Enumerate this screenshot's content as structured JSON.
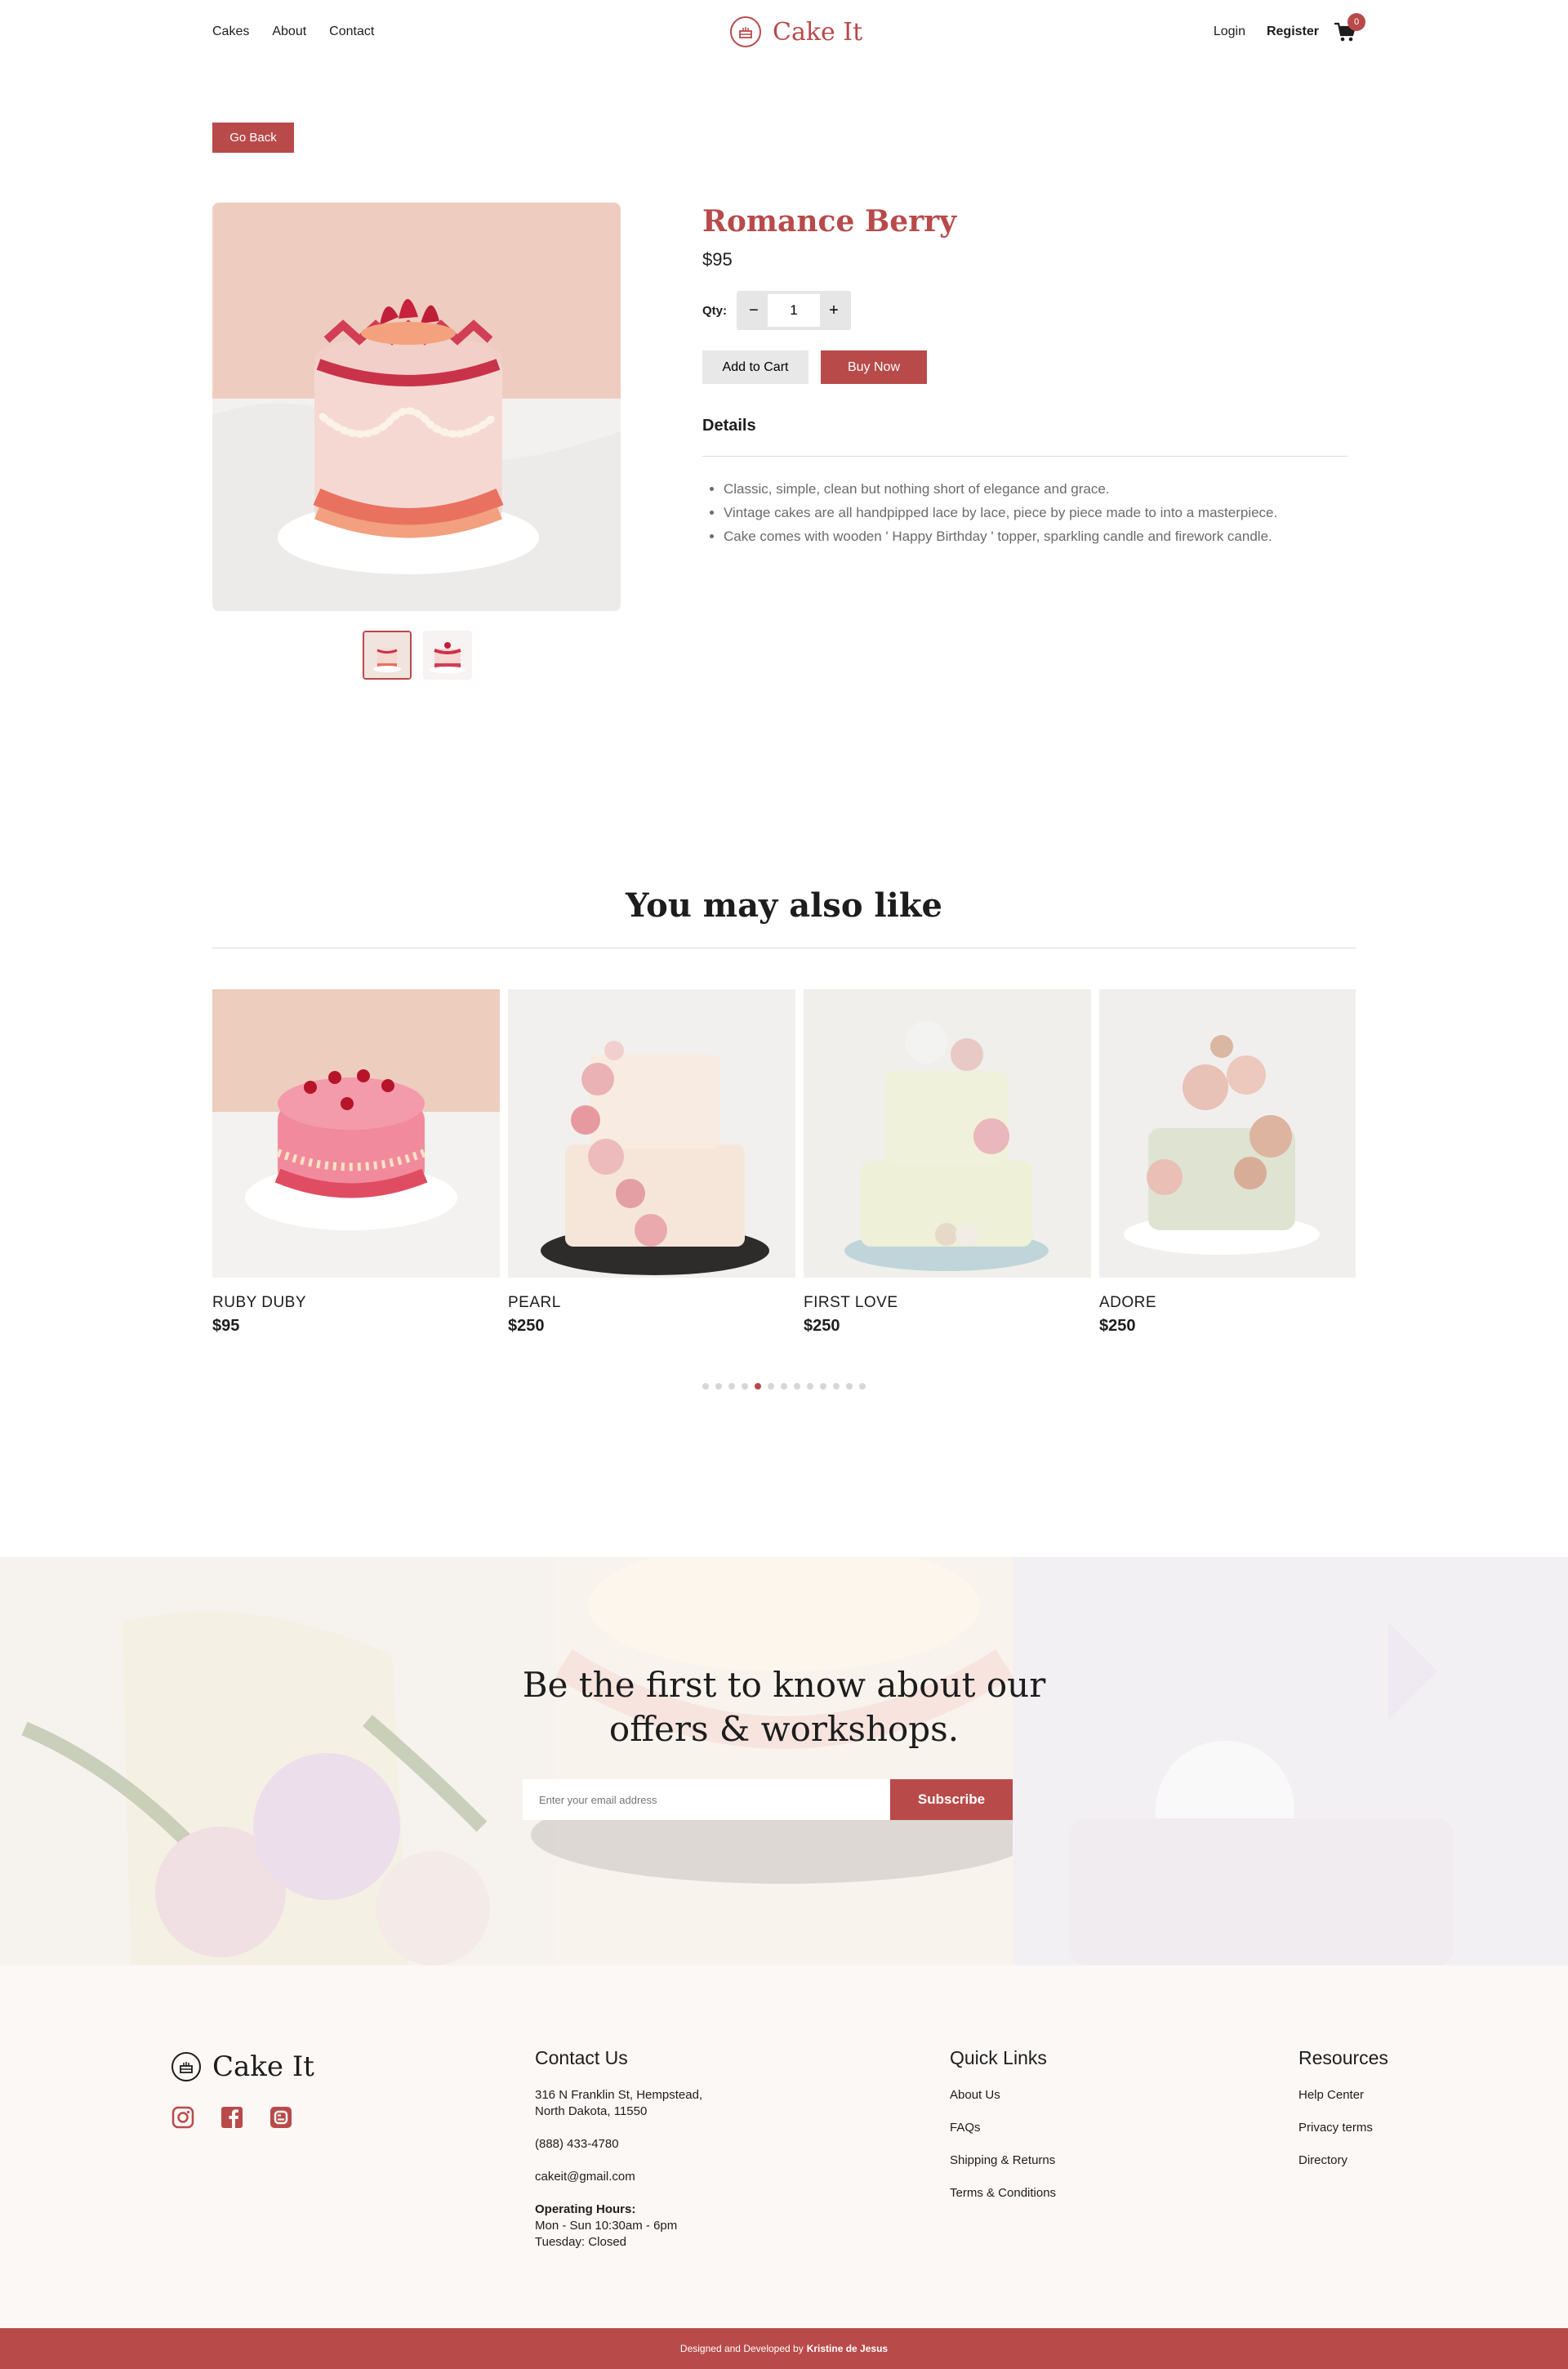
{
  "nav": {
    "cakes": "Cakes",
    "about": "About",
    "contact": "Contact",
    "login": "Login",
    "register": "Register",
    "cart_count": "0"
  },
  "brand": {
    "name": "Cake It"
  },
  "go_back": "Go Back",
  "product": {
    "title": "Romance Berry",
    "price": "$95",
    "qty_label": "Qty:",
    "qty_value": "1",
    "qty_minus": "−",
    "qty_plus": "+",
    "add_to_cart": "Add to Cart",
    "buy_now": "Buy Now",
    "details_heading": "Details",
    "details": [
      "Classic, simple, clean but nothing short of elegance and grace.",
      "Vintage cakes are all handpipped lace by lace, piece by piece made to into a masterpiece.",
      "Cake comes with wooden ' Happy Birthday ' topper, sparkling candle and firework candle."
    ]
  },
  "also_like": {
    "title": "You may also like",
    "items": [
      {
        "name": "RUBY DUBY",
        "price": "$95"
      },
      {
        "name": "PEARL",
        "price": "$250"
      },
      {
        "name": "FIRST LOVE",
        "price": "$250"
      },
      {
        "name": "ADORE",
        "price": "$250"
      }
    ],
    "dots_count": 13,
    "active_dot": 4
  },
  "newsletter": {
    "title_line1": "Be the first to know about our",
    "title_line2": "offers & workshops.",
    "placeholder": "Enter your email address",
    "button": "Subscribe"
  },
  "footer": {
    "brand": "Cake It",
    "contact": {
      "heading": "Contact Us",
      "address1": "316 N Franklin St, Hempstead,",
      "address2": "North Dakota, 11550",
      "phone": "(888) 433-4780",
      "email": "cakeit@gmail.com",
      "hours_label": "Operating Hours:",
      "hours1": "Mon - Sun 10:30am - 6pm",
      "hours2": "Tuesday: Closed"
    },
    "quick_links": {
      "heading": "Quick Links",
      "links": [
        "About Us",
        "FAQs",
        "Shipping & Returns",
        "Terms & Conditions"
      ]
    },
    "resources": {
      "heading": "Resources",
      "links": [
        "Help Center",
        "Privacy terms",
        "Directory"
      ]
    },
    "credit_prefix": "Designed and Developed by",
    "credit_name": "Kristine de Jesus"
  },
  "colors": {
    "accent": "#b94a4a",
    "footer_bg": "#fcf8f6"
  },
  "icons": [
    "cake-icon",
    "cart-icon",
    "instagram-icon",
    "facebook-icon",
    "blogger-icon"
  ]
}
